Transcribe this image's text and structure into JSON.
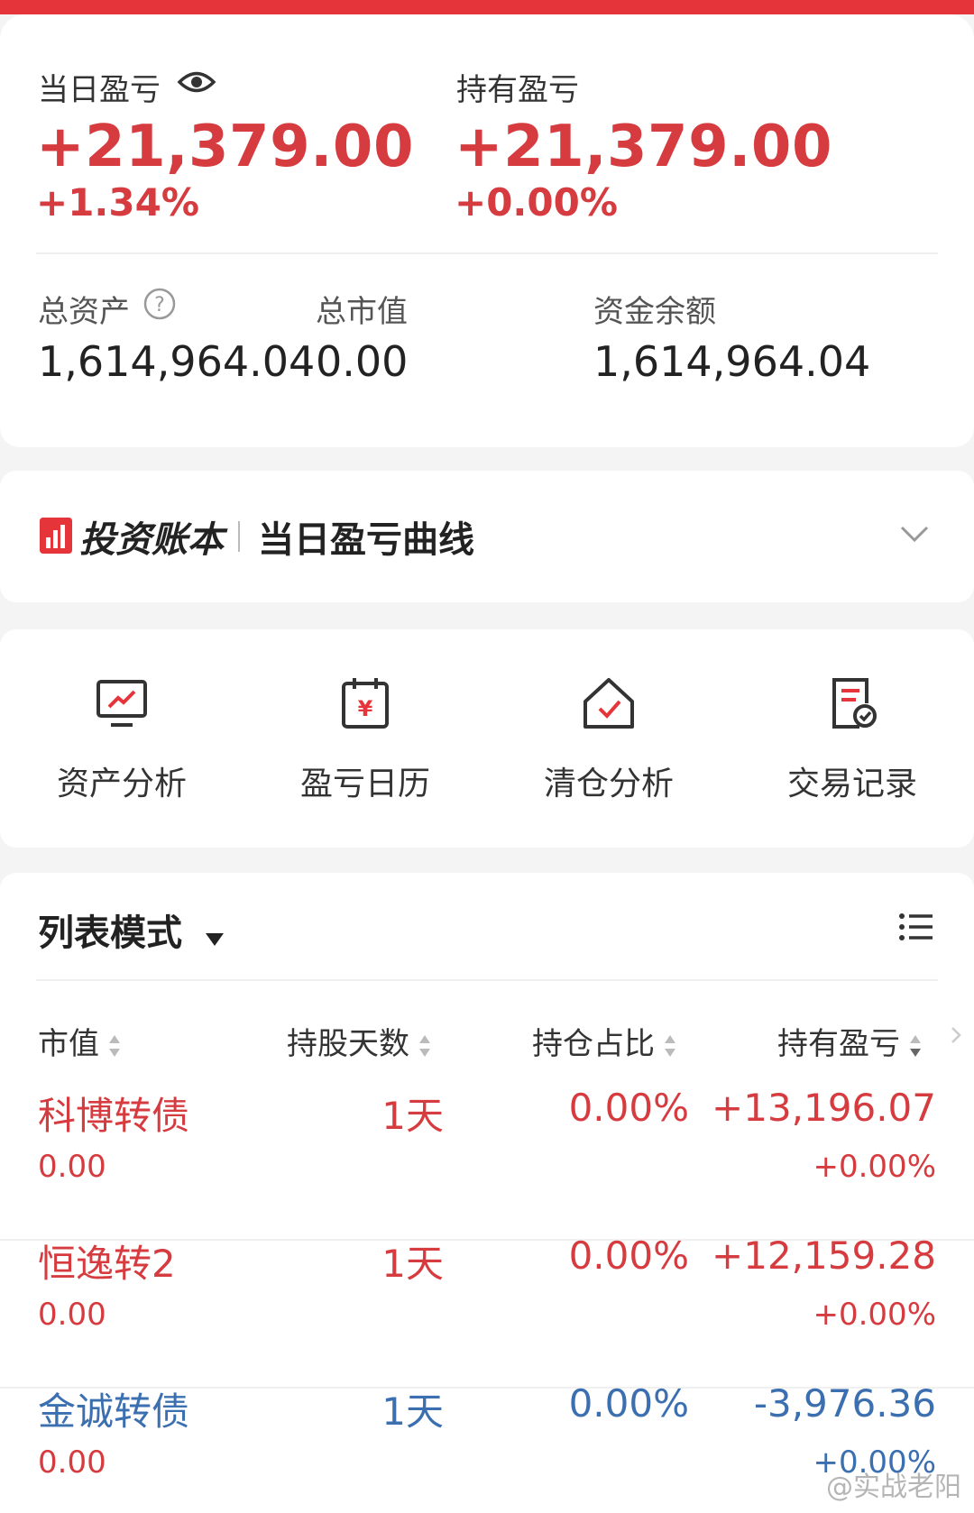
{
  "summary": {
    "daily_pl_label": "当日盈亏",
    "daily_pl_value": "+21,379.00",
    "daily_pl_pct": "+1.34%",
    "holding_pl_label": "持有盈亏",
    "holding_pl_value": "+21,379.00",
    "holding_pl_pct": "+0.00%",
    "total_assets_label": "总资产",
    "total_assets_value": "1,614,964.04",
    "market_value_label": "总市值",
    "market_value_value": "0.00",
    "cash_balance_label": "资金余额",
    "cash_balance_value": "1,614,964.04"
  },
  "ledger": {
    "brand": "投资账本",
    "title": "当日盈亏曲线",
    "logo_icon": "ledger-logo-icon"
  },
  "tools": [
    {
      "label": "资产分析",
      "icon": "monitor-chart-icon"
    },
    {
      "label": "盈亏日历",
      "icon": "calendar-yen-icon"
    },
    {
      "label": "清仓分析",
      "icon": "house-check-icon"
    },
    {
      "label": "交易记录",
      "icon": "document-check-icon"
    }
  ],
  "list": {
    "mode_label": "列表模式",
    "columns": [
      "市值",
      "持股天数",
      "持仓占比",
      "持有盈亏"
    ],
    "rows": [
      {
        "name": "科博转债",
        "market_value": "0.00",
        "days": "1天",
        "ratio": "0.00%",
        "pl": "+13,196.07",
        "pl_pct": "+0.00%",
        "trend": "up"
      },
      {
        "name": "恒逸转2",
        "market_value": "0.00",
        "days": "1天",
        "ratio": "0.00%",
        "pl": "+12,159.28",
        "pl_pct": "+0.00%",
        "trend": "up"
      },
      {
        "name": "金诚转债",
        "market_value": "0.00",
        "days": "1天",
        "ratio": "0.00%",
        "pl": "-3,976.36",
        "pl_pct": "+0.00%",
        "trend": "down"
      }
    ]
  },
  "watermark": "@实战老阳",
  "colors": {
    "accent_red": "#e6353a",
    "gain_red": "#d63b3f",
    "loss_blue": "#3b6fb0"
  }
}
